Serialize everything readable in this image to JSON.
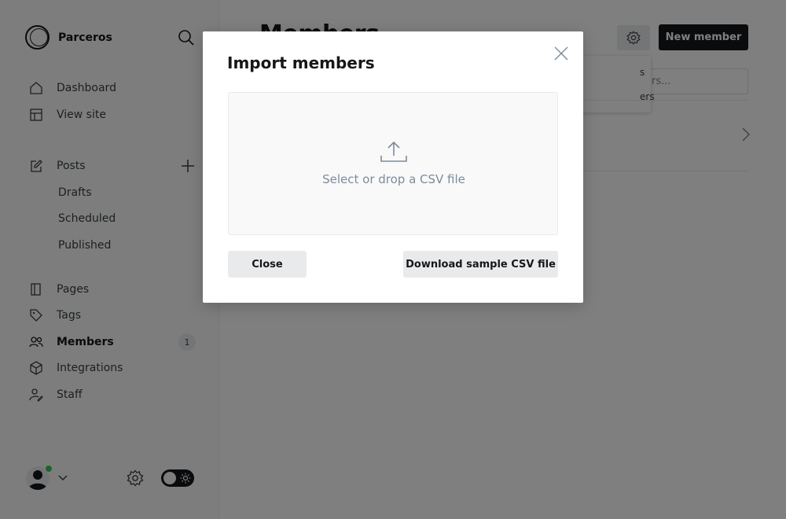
{
  "sidebar": {
    "brand": {
      "name": "Parceros",
      "logo_icon": "circle-logo-icon"
    },
    "search_icon": "search-icon",
    "nav": {
      "dashboard": {
        "label": "Dashboard",
        "icon": "home-icon"
      },
      "view_site": {
        "label": "View site",
        "icon": "layout-icon"
      },
      "posts": {
        "label": "Posts",
        "icon": "edit-icon"
      },
      "drafts": {
        "label": "Drafts"
      },
      "scheduled": {
        "label": "Scheduled"
      },
      "published": {
        "label": "Published"
      },
      "pages": {
        "label": "Pages",
        "icon": "page-icon"
      },
      "tags": {
        "label": "Tags",
        "icon": "tag-icon"
      },
      "members": {
        "label": "Members",
        "icon": "members-icon",
        "count": "1"
      },
      "integrations": {
        "label": "Integrations",
        "icon": "cube-icon"
      },
      "staff": {
        "label": "Staff",
        "icon": "staff-icon"
      }
    },
    "footer": {
      "online_status_color": "#30cf43"
    }
  },
  "main": {
    "title": "Members",
    "new_member_label": "New member",
    "search_placeholder_visible": "ers...",
    "dropdown": {
      "option1_visible": "s",
      "option2_visible": "ers"
    }
  },
  "modal": {
    "title": "Import members",
    "dropzone_text": "Select or drop a CSV file",
    "close_label": "Close",
    "sample_label": "Download sample CSV file"
  },
  "colors": {
    "accent_dark": "#15171a",
    "overlay": "rgba(0,0,0,0.5)",
    "button_gray": "#e9eaec",
    "muted_text": "#7c8b9a"
  }
}
